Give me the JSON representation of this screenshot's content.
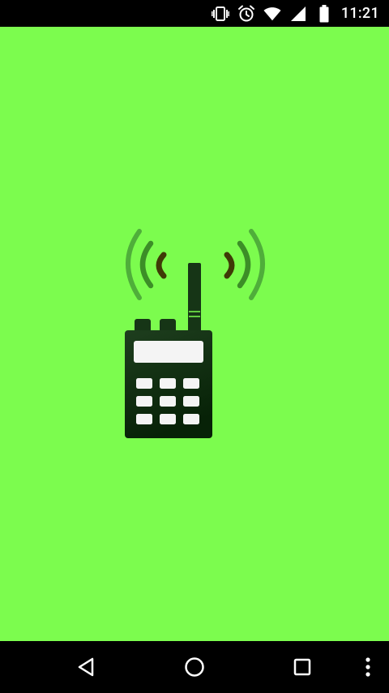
{
  "status_bar": {
    "time": "11:21",
    "icons": [
      "vibrate-icon",
      "alarm-icon",
      "wifi-icon",
      "cell-signal-icon",
      "battery-icon"
    ]
  },
  "content": {
    "background": "#7CFC4E",
    "icon": "walkie-talkie-icon"
  },
  "nav_bar": {
    "buttons": [
      "back-icon",
      "home-icon",
      "recents-icon",
      "menu-overflow-icon"
    ]
  }
}
